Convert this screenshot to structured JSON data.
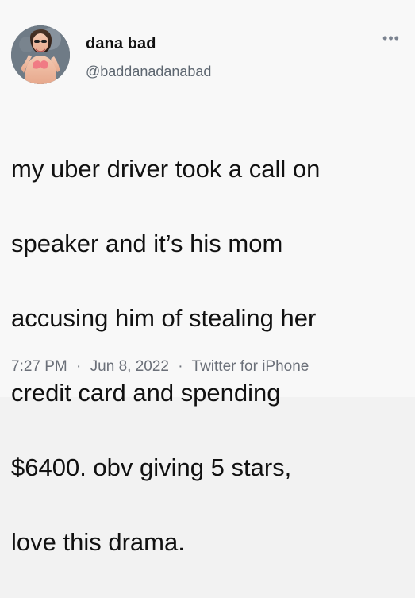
{
  "tweet": {
    "author": {
      "name": "dana bad",
      "handle": "@baddanadanabad"
    },
    "text_lines": [
      "my uber driver took a call on",
      "speaker and it’s his mom",
      "accusing him of stealing her",
      "credit card and spending",
      "$6400. obv giving 5 stars,",
      "love this drama."
    ],
    "time": "7:27 PM",
    "date": "Jun 8, 2022",
    "source": "Twitter for iPhone",
    "separator": "·"
  },
  "icons": {
    "more": "more-horizontal-icon"
  },
  "colors": {
    "text": "#111111",
    "muted": "#6b7079",
    "background": "#f8f8f8"
  }
}
